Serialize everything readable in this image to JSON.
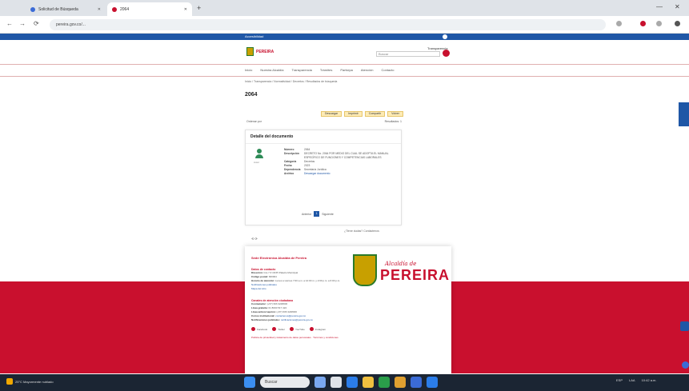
{
  "browser": {
    "tabs": [
      {
        "label": "Solicitud de Búsqueda"
      },
      {
        "label": "2064"
      }
    ],
    "new_tab": "+",
    "url": "pereira.gov.co/...",
    "nav": {
      "back": "←",
      "forward": "→",
      "reload": "⟳"
    },
    "window": {
      "minimize": "—",
      "close": "✕"
    }
  },
  "site": {
    "accessibility_label": "Accesibilidad",
    "logo_text": "PEREIRA",
    "search_placeholder": "Buscar",
    "header_link": "Transparencia",
    "nav_items": [
      "Inicio",
      "Nuestra Alcaldía",
      "Transparencia",
      "Trámites",
      "Participa",
      "Atención",
      "Contacto"
    ]
  },
  "breadcrumb": "Inicio / Transparencia / Normatividad / Decretos / Resultados de búsqueda",
  "page_title": "2064",
  "action_buttons": [
    "Descargar",
    "Imprimir",
    "Compartir",
    "Volver"
  ],
  "sort": {
    "left": "Ordenar por",
    "right": "Resultados: 1"
  },
  "record": {
    "heading": "Detalle del documento",
    "avatar_caption": "Autor",
    "fields": [
      {
        "key": "Número",
        "value": "2064"
      },
      {
        "key": "Descripción",
        "value": "DECRETO No. 2064 POR MEDIO DEL CUAL SE ADOPTA EL MANUAL ESPECÍFICO DE FUNCIONES Y COMPETENCIAS LABORALES"
      },
      {
        "key": "Categoría",
        "value": "Decretos"
      },
      {
        "key": "Fecha",
        "value": "2023"
      },
      {
        "key": "Dependencia",
        "value": "Secretaría Jurídica"
      },
      {
        "key": "Archivo",
        "value": "Descargar documento"
      }
    ]
  },
  "pager": {
    "prev": "Anterior",
    "current": "1",
    "next": "Siguiente"
  },
  "share_label": "⟲ ⟳",
  "contact_link": "¿Tiene dudas? Contáctenos",
  "footer": {
    "title": "Sede Electrónica Alcaldía de Pereira",
    "brand_small": "Alcaldía de",
    "brand": "PEREIRA",
    "sections": [
      {
        "heading": "Datos de contacto",
        "lines": [
          {
            "label": "Dirección:",
            "text": "Cra 7 # 18-55 Palacio Municipal"
          },
          {
            "label": "Código postal:",
            "text": "660004"
          },
          {
            "label": "Horario de atención:",
            "text": "Lunes a viernes 7:00 a.m. a 12:00 m. y 2:00 p.m. a 6:00 p.m."
          },
          {
            "label": "",
            "text": "Notificaciones judiciales"
          },
          {
            "label": "",
            "text": "Mapa del sitio"
          }
        ]
      },
      {
        "heading": "Canales de atención ciudadana",
        "lines": [
          {
            "label": "Conmutador:",
            "text": "(+57) 606 3248000"
          },
          {
            "label": "Línea gratuita:",
            "text": "01 8000 517 424"
          },
          {
            "label": "Línea anticorrupción:",
            "text": "(+57) 606 3248000"
          },
          {
            "label": "Correo institucional:",
            "text": "contactenos@pereira.gov.co"
          },
          {
            "label": "Notificaciones judiciales:",
            "text": "notificaciones@pereira.gov.co"
          }
        ]
      }
    ],
    "social": [
      "Facebook",
      "Twitter",
      "YouTube",
      "Instagram"
    ],
    "bottom_note": "Política de privacidad y tratamiento de datos personales · Términos y condiciones"
  },
  "taskbar": {
    "weather": "25°C Mayormente nublado",
    "search": "Buscar",
    "tray": [
      "ESP",
      "LAA",
      "10:42 a.m."
    ]
  }
}
